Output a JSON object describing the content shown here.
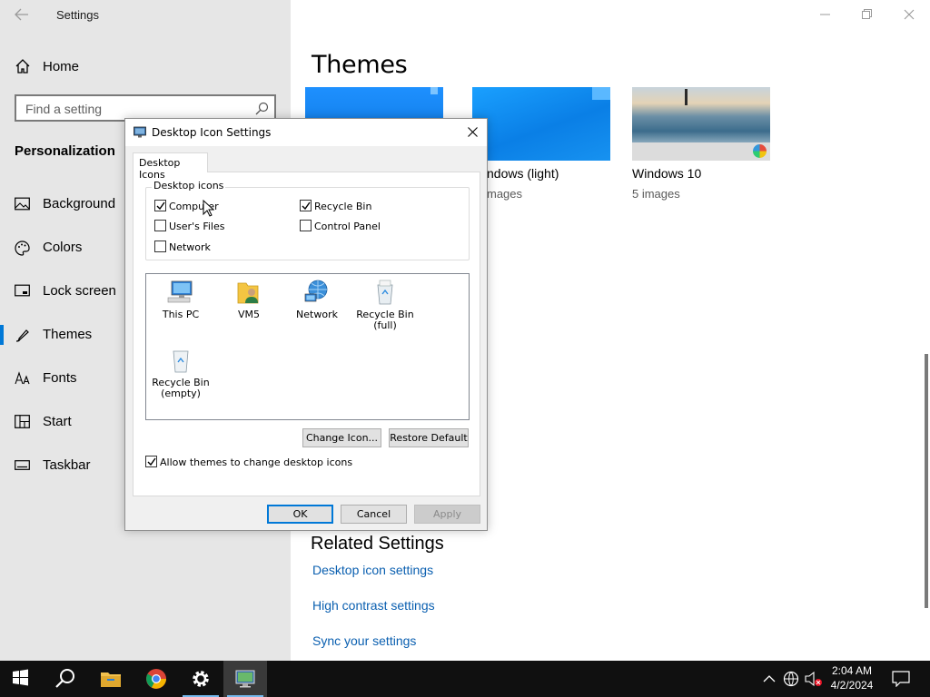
{
  "settings": {
    "app_title": "Settings",
    "home_label": "Home",
    "search_placeholder": "Find a setting",
    "section_title": "Personalization",
    "nav_items": [
      {
        "label": "Background",
        "icon": "picture-icon"
      },
      {
        "label": "Colors",
        "icon": "palette-icon"
      },
      {
        "label": "Lock screen",
        "icon": "lock-screen-icon"
      },
      {
        "label": "Themes",
        "icon": "brush-icon",
        "selected": true
      },
      {
        "label": "Fonts",
        "icon": "font-icon"
      },
      {
        "label": "Start",
        "icon": "start-tiles-icon"
      },
      {
        "label": "Taskbar",
        "icon": "taskbar-icon"
      }
    ],
    "content": {
      "title": "Themes",
      "themes": [
        {
          "name": "",
          "count": ""
        },
        {
          "name": "ndows (light)",
          "count": "mages"
        },
        {
          "name": "Windows 10",
          "count": "5 images"
        }
      ],
      "related_title": "Related Settings",
      "related_links": [
        "Desktop icon settings",
        "High contrast settings",
        "Sync your settings"
      ]
    }
  },
  "dialog": {
    "title": "Desktop Icon Settings",
    "tab_label": "Desktop Icons",
    "group_label": "Desktop icons",
    "checkboxes": [
      {
        "label": "Computer",
        "checked": true
      },
      {
        "label": "Recycle Bin",
        "checked": true
      },
      {
        "label": "User's Files",
        "checked": false
      },
      {
        "label": "Control Panel",
        "checked": false
      },
      {
        "label": "Network",
        "checked": false
      }
    ],
    "icons": [
      {
        "caption": "This PC",
        "icon": "computer-icon"
      },
      {
        "caption": "VM5",
        "icon": "user-folder-icon"
      },
      {
        "caption": "Network",
        "icon": "network-icon"
      },
      {
        "caption": "Recycle Bin\n(full)",
        "icon": "recycle-bin-full-icon"
      },
      {
        "caption": "Recycle Bin\n(empty)",
        "icon": "recycle-bin-empty-icon"
      }
    ],
    "change_icon_label": "Change Icon...",
    "restore_default_label": "Restore Default",
    "allow_themes_label": "Allow themes to change desktop icons",
    "allow_themes_checked": true,
    "ok_label": "OK",
    "cancel_label": "Cancel",
    "apply_label": "Apply"
  },
  "taskbar": {
    "time": "2:04 AM",
    "date": "4/2/2024",
    "pinned": [
      "start-icon",
      "search-icon",
      "file-explorer-icon",
      "chrome-icon",
      "settings-gear-icon",
      "desktop-icon-settings-app-icon"
    ]
  },
  "colors": {
    "accent": "#0078d7",
    "link": "#0a5fb0",
    "sidebar_bg": "#e6e6e6",
    "taskbar_bg": "#101010"
  }
}
